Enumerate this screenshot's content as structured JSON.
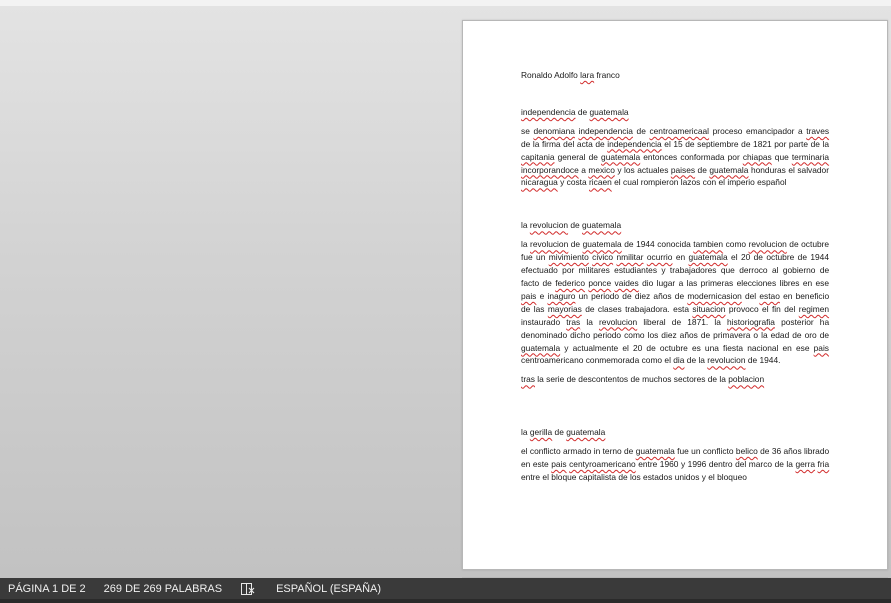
{
  "document": {
    "author": "Ronaldo Adolfo lara franco",
    "sections": [
      {
        "heading": "independencia de guatemala",
        "paragraphs": [
          "se denomiana independencia de centroamericaal proceso emancipador a traves de la firma del acta de independencia el 15 de septiembre de 1821 por parte de la capitania general de guatemala entonces conformada por chiapas que terminaria incorporandoce a mexico y los actuales paises de guatemala honduras el salvador nicaragua y costa ricaen el cual rompieron lazos con el imperio español"
        ]
      },
      {
        "heading": "la revolucion de guatemala",
        "paragraphs": [
          "la revolucion de guatemala de 1944 conocida tambien como revolucion de octubre fue un mivimiento civico nmilitar ocurrio en guatemala el 20 de octubre de 1944 efectuado por militares estudiantes y trabajadores que derroco al gobierno de facto de federico ponce vaides dio lugar a las primeras elecciones libres en ese pais e inaguro un periodo de diez años de modernicasion del estao en beneficio de las mayorias de clases trabajadora. esta situacion provoco el fin del regimen instaurado tras la revolucion liberal de 1871. la historiografia posterior ha denominado dicho periodo como los diez años de primavera o la edad de oro de guatemala y actualmente el 20 de octubre es una fiesta nacional en ese pais centroamericano conmemorada como el dia de la revolucion de 1944.",
          "tras la serie de descontentos de muchos sectores de la poblacion"
        ]
      },
      {
        "heading": "la gerilla de guatemala",
        "paragraphs": [
          "el conflicto armado in terno de guatemala fue un conflicto belico de 36 años librado en este pais centyroamericano entre 1960 y 1996 dentro del marco de la gerra fria entre el bloque capitalista de los estados unidos y el bloqueo"
        ]
      }
    ]
  },
  "statusbar": {
    "page": "PÁGINA 1 DE 2",
    "words": "269 DE 269 PALABRAS",
    "proofing_icon": "book-check-icon",
    "language": "ESPAÑOL (ESPAÑA)"
  },
  "colors": {
    "statusbar_bg": "#3a3a3a",
    "spell_error": "#d12a2a",
    "grammar_error": "#2a4fd1"
  }
}
